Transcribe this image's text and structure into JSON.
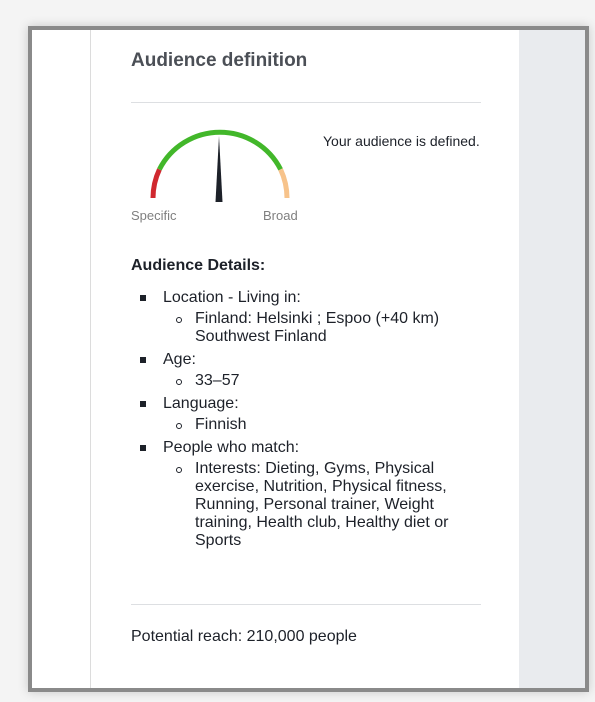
{
  "title": "Audience definition",
  "gauge": {
    "status_text": "Your audience is defined.",
    "label_left": "Specific",
    "label_right": "Broad",
    "colors": {
      "specific": "#d0282f",
      "good": "#42b72a",
      "broad": "#f7c38b",
      "needle": "#1d2129"
    }
  },
  "details": {
    "title": "Audience Details:",
    "items": [
      {
        "label": "Location - Living in:",
        "sub": [
          "Finland: Helsinki ; Espoo (+40 km) Southwest Finland"
        ]
      },
      {
        "label": "Age:",
        "sub": [
          "33–57"
        ]
      },
      {
        "label": "Language:",
        "sub": [
          "Finnish"
        ]
      },
      {
        "label": "People who match:",
        "sub": [
          "Interests: Dieting, Gyms, Physical exercise, Nutrition, Physical fitness, Running, Personal trainer, Weight training, Health club, Healthy diet or Sports"
        ]
      }
    ]
  },
  "reach_text": "Potential reach: 210,000 people"
}
